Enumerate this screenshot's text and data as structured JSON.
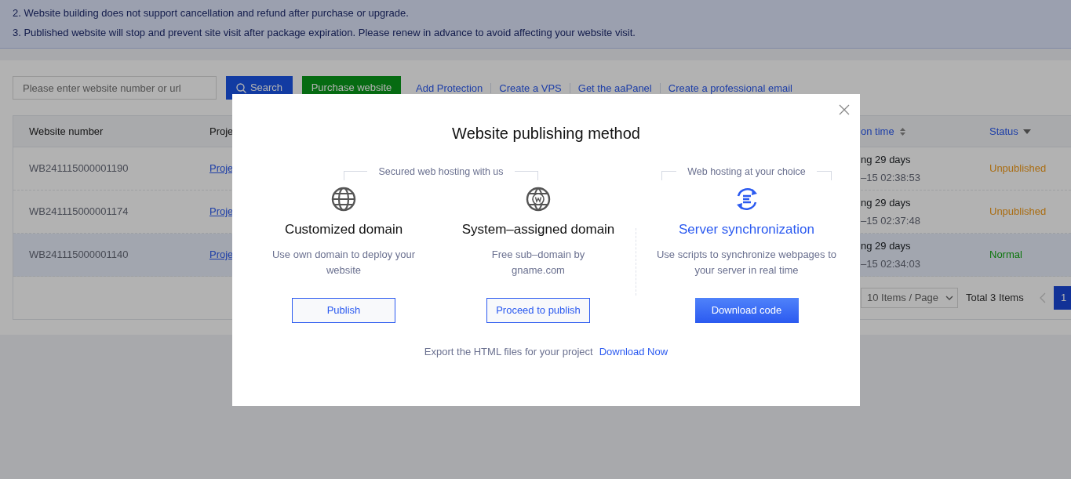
{
  "notices": [
    "2. Website building does not support cancellation and refund after purchase or upgrade.",
    "3. Published website will stop and prevent site visit after package expiration. Please renew in advance to avoid affecting your website visit."
  ],
  "toolbar": {
    "search": {
      "placeholder": "Please enter website number or url"
    },
    "search_button": "Search",
    "purchase_button": "Purchase website",
    "links": [
      "Add Protection",
      "Create a VPS",
      "Get the aaPanel",
      "Create a professional email"
    ]
  },
  "table": {
    "columns": [
      {
        "label": "Website number",
        "kind": "plain"
      },
      {
        "label": "Proje",
        "kind": "plain"
      },
      {
        "label": "on time",
        "kind": "sort"
      },
      {
        "label": "Status",
        "kind": "filter"
      }
    ],
    "rows": [
      {
        "number": "WB241115000001190",
        "project": "Proje",
        "time_1": "ng 29 days",
        "time_2": "–15 02:38:53",
        "status": "Unpublished",
        "color": "#aa6d12",
        "selected": false
      },
      {
        "number": "WB241115000001174",
        "project": "Proje",
        "time_1": "ng 29 days",
        "time_2": "–15 02:37:48",
        "status": "Unpublished",
        "color": "#aa6d12",
        "selected": false
      },
      {
        "number": "WB241115000001140",
        "project": "Proje",
        "time_1": "ng 29 days",
        "time_2": "–15 02:34:03",
        "status": "Normal",
        "color": "#0d760d",
        "selected": true
      }
    ]
  },
  "pagination": {
    "page_size": "10 Items / Page",
    "total": "Total 3 Items",
    "pages": [
      {
        "label": "1",
        "selected": true
      }
    ]
  },
  "modal": {
    "title": "Website publishing method",
    "groups": [
      {
        "label": "Secured web hosting with us"
      },
      {
        "label": "Web hosting at your choice"
      }
    ],
    "options": [
      {
        "kind": "domain",
        "title": "Customized domain",
        "description": "Use own domain to deploy your website",
        "button": "Publish"
      },
      {
        "kind": "domain",
        "title": "System–assigned domain",
        "description": "Free sub–domain by gname.com",
        "button": "Proceed to publish"
      },
      {
        "kind": "sync",
        "title": "Server synchronization",
        "description": "Use scripts to synchronize webpages to your server in real time",
        "button": "Download code"
      }
    ],
    "footer_text": "Export the HTML files for your project",
    "footer_link": "Download Now"
  }
}
